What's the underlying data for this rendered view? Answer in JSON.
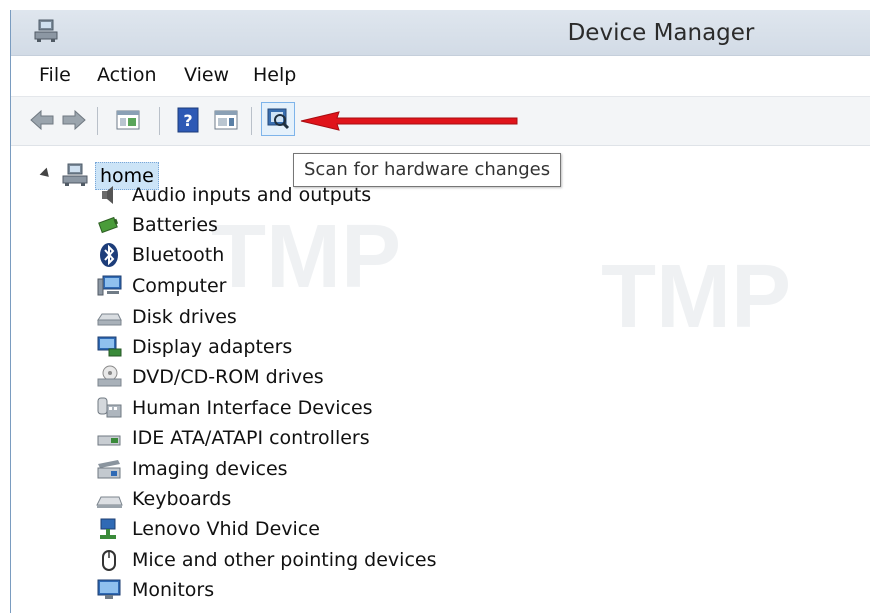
{
  "window": {
    "title": "Device Manager"
  },
  "menu": {
    "file": "File",
    "action": "Action",
    "view": "View",
    "help": "Help"
  },
  "toolbar": {
    "tooltip": "Scan for hardware changes"
  },
  "tree": {
    "root": "home",
    "items": [
      {
        "label": "Audio inputs and outputs",
        "icon": "speaker-icon"
      },
      {
        "label": "Batteries",
        "icon": "battery-icon"
      },
      {
        "label": "Bluetooth",
        "icon": "bluetooth-icon"
      },
      {
        "label": "Computer",
        "icon": "computer-icon"
      },
      {
        "label": "Disk drives",
        "icon": "disk-drive-icon"
      },
      {
        "label": "Display adapters",
        "icon": "display-adapter-icon"
      },
      {
        "label": "DVD/CD-ROM drives",
        "icon": "dvd-drive-icon"
      },
      {
        "label": "Human Interface Devices",
        "icon": "hid-icon"
      },
      {
        "label": "IDE ATA/ATAPI controllers",
        "icon": "ide-controller-icon"
      },
      {
        "label": "Imaging devices",
        "icon": "scanner-icon"
      },
      {
        "label": "Keyboards",
        "icon": "keyboard-icon"
      },
      {
        "label": "Lenovo Vhid Device",
        "icon": "lenovo-device-icon"
      },
      {
        "label": "Mice and other pointing devices",
        "icon": "mouse-icon"
      },
      {
        "label": "Monitors",
        "icon": "monitor-icon"
      }
    ]
  },
  "colors": {
    "selection": "#cce4f7",
    "arrow": "#e0141b",
    "titlebar": "#d7e0ea"
  }
}
